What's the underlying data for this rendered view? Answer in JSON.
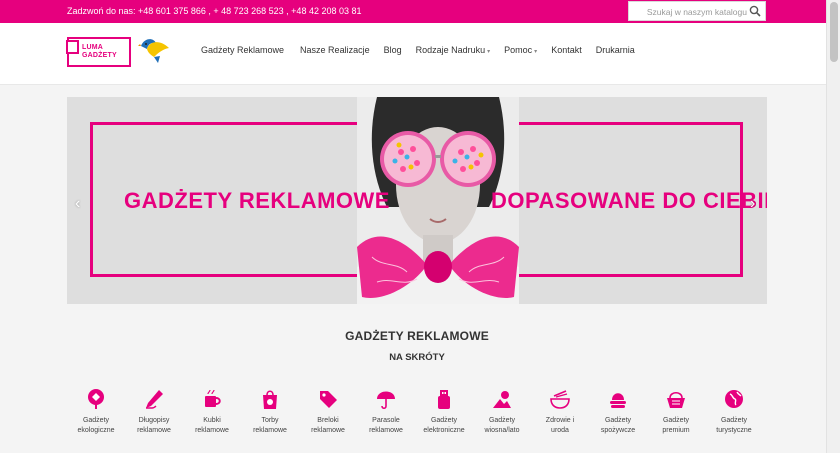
{
  "topbar": {
    "phones": "Zadzwoń do nas: +48 601 375 866 , + 48 723 268 523 , +48 42 208 03 81",
    "search_placeholder": "Szukaj w naszym katalogu"
  },
  "header": {
    "logo_line1": "LUMA",
    "logo_line2": "GADŻETY",
    "nav": [
      {
        "label": "Gadżety Reklamowe",
        "dropdown": false
      },
      {
        "label": "Nasze Realizacje",
        "dropdown": false
      },
      {
        "label": "Blog",
        "dropdown": false
      },
      {
        "label": "Rodzaje Nadruku",
        "dropdown": true
      },
      {
        "label": "Pomoc",
        "dropdown": true
      },
      {
        "label": "Kontakt",
        "dropdown": false
      },
      {
        "label": "Drukarnia",
        "dropdown": false
      }
    ],
    "caret": "▾"
  },
  "slider": {
    "headline_left": "GADŻETY REKLAMOWE",
    "headline_right": "DOPASOWANE DO CIEBIE",
    "prev": "‹",
    "next": "›"
  },
  "section": {
    "title": "GADŻETY REKLAMOWE",
    "subtitle": "NA SKRÓTY"
  },
  "categories": [
    {
      "icon": "tree-icon",
      "line1": "Gadżety",
      "line2": "ekologiczne"
    },
    {
      "icon": "pen-icon",
      "line1": "Długopisy",
      "line2": "reklamowe"
    },
    {
      "icon": "mug-icon",
      "line1": "Kubki",
      "line2": "reklamowe"
    },
    {
      "icon": "bag-icon",
      "line1": "Torby",
      "line2": "reklamowe"
    },
    {
      "icon": "tag-icon",
      "line1": "Breloki",
      "line2": "reklamowe"
    },
    {
      "icon": "umbrella-icon",
      "line1": "Parasole",
      "line2": "reklamowe"
    },
    {
      "icon": "usb-icon",
      "line1": "Gadżety",
      "line2": "elektroniczne"
    },
    {
      "icon": "sun-icon",
      "line1": "Gadżety",
      "line2": "wiosna/lato"
    },
    {
      "icon": "bowl-icon",
      "line1": "Zdrowie i",
      "line2": "uroda"
    },
    {
      "icon": "food-icon",
      "line1": "Gadżety",
      "line2": "spożywcze"
    },
    {
      "icon": "basket-icon",
      "line1": "Gadżety",
      "line2": "premium"
    },
    {
      "icon": "globe-icon",
      "line1": "Gadżety",
      "line2": "turystyczne"
    }
  ],
  "colors": {
    "brand": "#e6007e",
    "text": "#333333",
    "bird_blue": "#1f6fb8",
    "bird_yellow": "#f5c400"
  }
}
